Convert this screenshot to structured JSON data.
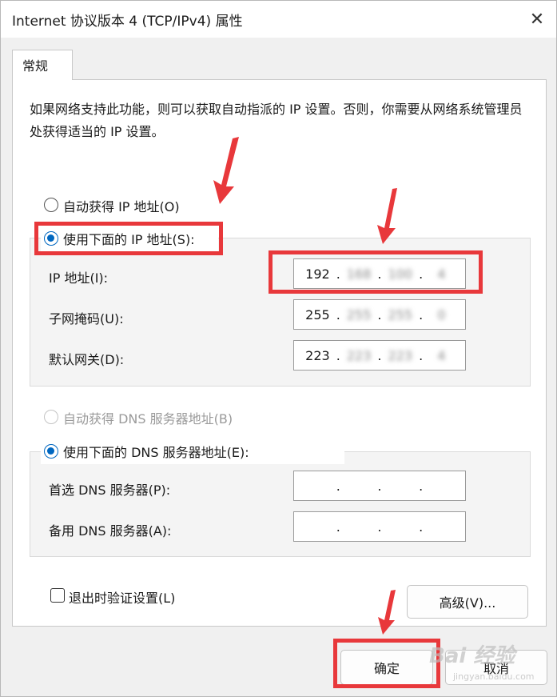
{
  "window": {
    "title": "Internet 协议版本 4 (TCP/IPv4) 属性",
    "close_glyph": "✕"
  },
  "tab": {
    "label": "常规"
  },
  "description": "如果网络支持此功能，则可以获取自动指派的 IP 设置。否则，你需要从网络系统管理员处获得适当的 IP 设置。",
  "ip_section": {
    "auto_label": "自动获得 IP 地址(O)",
    "manual_label": "使用下面的 IP 地址(S):",
    "selected": "manual",
    "fields": [
      {
        "label": "IP 地址(I):",
        "octets": [
          "192",
          "168",
          "100",
          "4"
        ]
      },
      {
        "label": "子网掩码(U):",
        "octets": [
          "255",
          "255",
          "255",
          "0"
        ]
      },
      {
        "label": "默认网关(D):",
        "octets": [
          "223",
          "223",
          "223",
          "4"
        ]
      }
    ]
  },
  "dns_section": {
    "auto_label": "自动获得 DNS 服务器地址(B)",
    "manual_label": "使用下面的 DNS 服务器地址(E):",
    "selected": "manual",
    "fields": [
      {
        "label": "首选 DNS 服务器(P):"
      },
      {
        "label": "备用 DNS 服务器(A):"
      }
    ]
  },
  "validate_on_exit": {
    "label": "退出时验证设置(L)",
    "checked": false
  },
  "buttons": {
    "advanced": "高级(V)...",
    "ok": "确定",
    "cancel": "取消"
  },
  "annotation_color": "#e8383b",
  "watermark": {
    "text": "Bai 经验",
    "sub": "jingyan.baidu.com"
  }
}
